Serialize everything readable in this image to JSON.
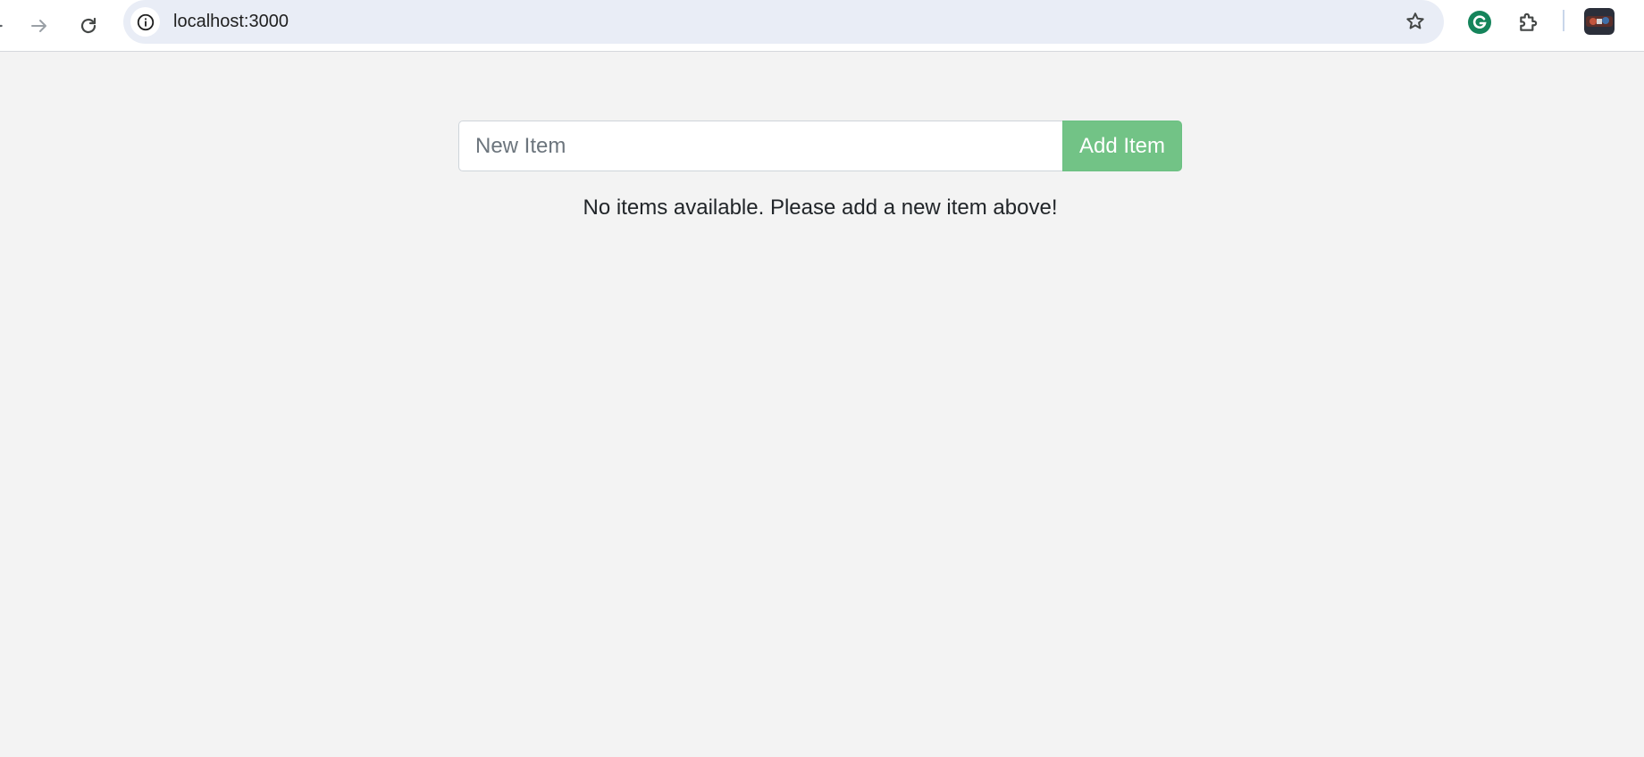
{
  "browser": {
    "url": "localhost:3000",
    "icons": {
      "back": "arrow-left-icon",
      "forward": "arrow-right-icon",
      "reload": "reload-icon",
      "site_info": "info-icon",
      "bookmark": "star-icon",
      "grammarly": "grammarly-icon",
      "extensions": "puzzle-icon",
      "profile": "avatar"
    },
    "colors": {
      "omnibox_bg": "#e9edf6",
      "grammarly": "#15c39a"
    }
  },
  "app": {
    "input": {
      "placeholder": "New Item",
      "value": ""
    },
    "add_button_label": "Add Item",
    "empty_message": "No items available. Please add a new item above!",
    "colors": {
      "page_bg": "#f3f3f3",
      "button_bg": "#72c386",
      "button_text": "#ffffff",
      "text": "#212529"
    }
  }
}
